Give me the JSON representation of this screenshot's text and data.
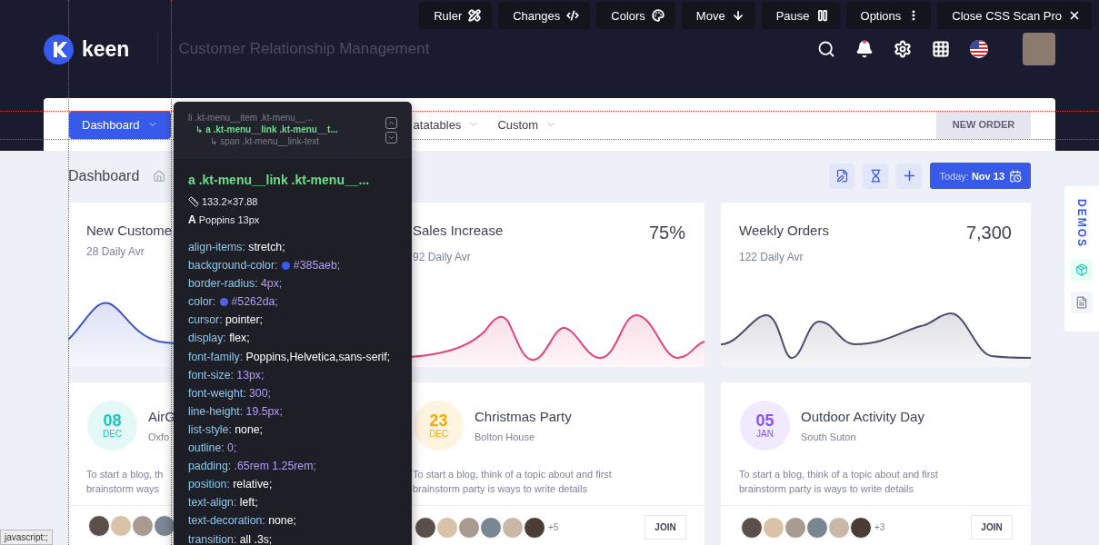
{
  "toolbar": {
    "buttons": [
      {
        "label": "Ruler"
      },
      {
        "label": "Changes"
      },
      {
        "label": "Colors"
      },
      {
        "label": "Move"
      },
      {
        "label": "Pause"
      },
      {
        "label": "Options"
      },
      {
        "label": "Close CSS Scan Pro"
      }
    ]
  },
  "header": {
    "brand": "keen",
    "subtitle": "Customer Relationship Management"
  },
  "menu": {
    "items": [
      {
        "label": "Dashboard",
        "selected": true
      },
      {
        "label": "atatables",
        "selected": false
      },
      {
        "label": "Custom",
        "selected": false
      }
    ],
    "action": "NEW ORDER"
  },
  "subheader": {
    "title": "Dashboard",
    "date": "Today: **Nov 13**"
  },
  "stats": [
    {
      "title": "New Custome",
      "subtitle": "28 Daily Avr",
      "color": "#3d55c8"
    },
    {
      "title": "Sales Increase",
      "subtitle": "92 Daily Avr",
      "value": "75%",
      "color": "#e0457b"
    },
    {
      "title": "Weekly Orders",
      "subtitle": "122 Daily Avr",
      "value": "7,300",
      "color": "#4a4d6b"
    }
  ],
  "events": [
    {
      "day": "08",
      "month": "DEC",
      "title": "AirG",
      "location": "Oxfo",
      "lines": [
        "To start a blog, th",
        "brainstorm ways"
      ],
      "color": "#1bc5bd"
    },
    {
      "day": "23",
      "month": "DEC",
      "title": "Christmas Party",
      "location": "Bolton House",
      "lines": [
        "To start a blog, think of a topic about and first",
        "brainstorm party is ways to write details"
      ],
      "more": "+5",
      "join": "JOIN",
      "color": "#ffa800"
    },
    {
      "day": "05",
      "month": "JAN",
      "title": "Outdoor Activity Day",
      "location": "South Suton",
      "lines": [
        "To start a blog, think of a topic about and first",
        "brainstorm party is ways to write details"
      ],
      "more": "+3",
      "join": "JOIN",
      "color": "#8950fc"
    }
  ],
  "demos": {
    "label": "DEMOS"
  },
  "inspector": {
    "path": [
      {
        "text": "li .kt-menu__item .kt-menu__...",
        "kind": "ancestor"
      },
      {
        "text": "↳ a .kt-menu__link .kt-menu__t...",
        "kind": "current"
      },
      {
        "text": "↳ span .kt-menu__link-text",
        "kind": "child"
      }
    ],
    "selector": "a .kt-menu__link .kt-menu__...",
    "size": "133.2×37.88",
    "font_glyph": "A",
    "font": "Poppins 13px",
    "properties": [
      {
        "name": "align-items:",
        "value": "stretch;",
        "kind": "keyword"
      },
      {
        "name": "background-color:",
        "value": "#385aeb;",
        "kind": "color",
        "color": "#385aeb"
      },
      {
        "name": "border-radius:",
        "value": "4px;",
        "kind": "number"
      },
      {
        "name": "color:",
        "value": "#5262da;",
        "kind": "color",
        "color": "#5262da"
      },
      {
        "name": "cursor:",
        "value": "pointer;",
        "kind": "keyword"
      },
      {
        "name": "display:",
        "value": "flex;",
        "kind": "keyword"
      },
      {
        "name": "font-family:",
        "value": "Poppins,Helvetica,sans-serif;",
        "kind": "keyword"
      },
      {
        "name": "font-size:",
        "value": "13px;",
        "kind": "number"
      },
      {
        "name": "font-weight:",
        "value": "300;",
        "kind": "number"
      },
      {
        "name": "line-height:",
        "value": "19.5px;",
        "kind": "number"
      },
      {
        "name": "list-style:",
        "value": "none;",
        "kind": "keyword"
      },
      {
        "name": "outline:",
        "value": "0;",
        "kind": "number"
      },
      {
        "name": "padding:",
        "value": ".65rem 1.25rem;",
        "kind": "number"
      },
      {
        "name": "position:",
        "value": "relative;",
        "kind": "keyword"
      },
      {
        "name": "text-align:",
        "value": "left;",
        "kind": "keyword"
      },
      {
        "name": "text-decoration:",
        "value": "none;",
        "kind": "keyword"
      },
      {
        "name": "transition:",
        "value": "all .3s;",
        "kind": "keyword"
      }
    ]
  },
  "status": "javascript:;"
}
